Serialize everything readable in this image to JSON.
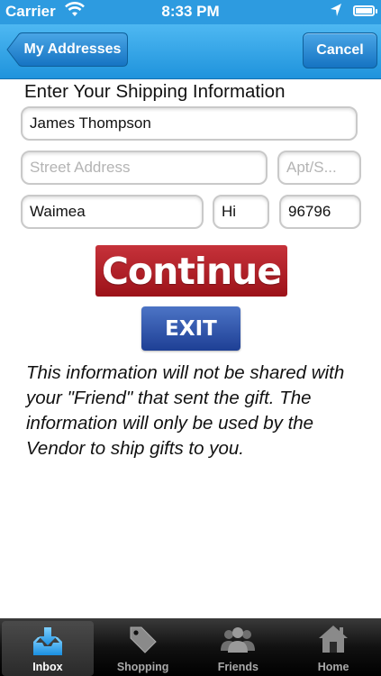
{
  "status_bar": {
    "carrier": "Carrier",
    "time": "8:33 PM"
  },
  "nav": {
    "back_label": "My Addresses",
    "cancel_label": "Cancel"
  },
  "form": {
    "heading": "Enter Your Shipping Information",
    "name_value": "James Thompson",
    "street_placeholder": "Street Address",
    "apt_placeholder": "Apt/S...",
    "city_value": "Waimea",
    "state_value": "Hi",
    "zip_value": "96796"
  },
  "buttons": {
    "continue_label": "Continue",
    "exit_label": "EXIT"
  },
  "info": {
    "text": "This information will not be shared with your \"Friend\" that sent the gift. The information will only be used by the Vendor to ship gifts to you."
  },
  "tab_bar": {
    "tabs": [
      {
        "label": "Inbox",
        "icon": "inbox-icon",
        "active": true
      },
      {
        "label": "Shopping",
        "icon": "tag-icon",
        "active": false
      },
      {
        "label": "Friends",
        "icon": "people-icon",
        "active": false
      },
      {
        "label": "Home",
        "icon": "home-icon",
        "active": false
      }
    ]
  },
  "colors": {
    "nav_blue": "#2d9be0",
    "continue_red": "#b01d25",
    "exit_blue": "#2f55ad"
  }
}
